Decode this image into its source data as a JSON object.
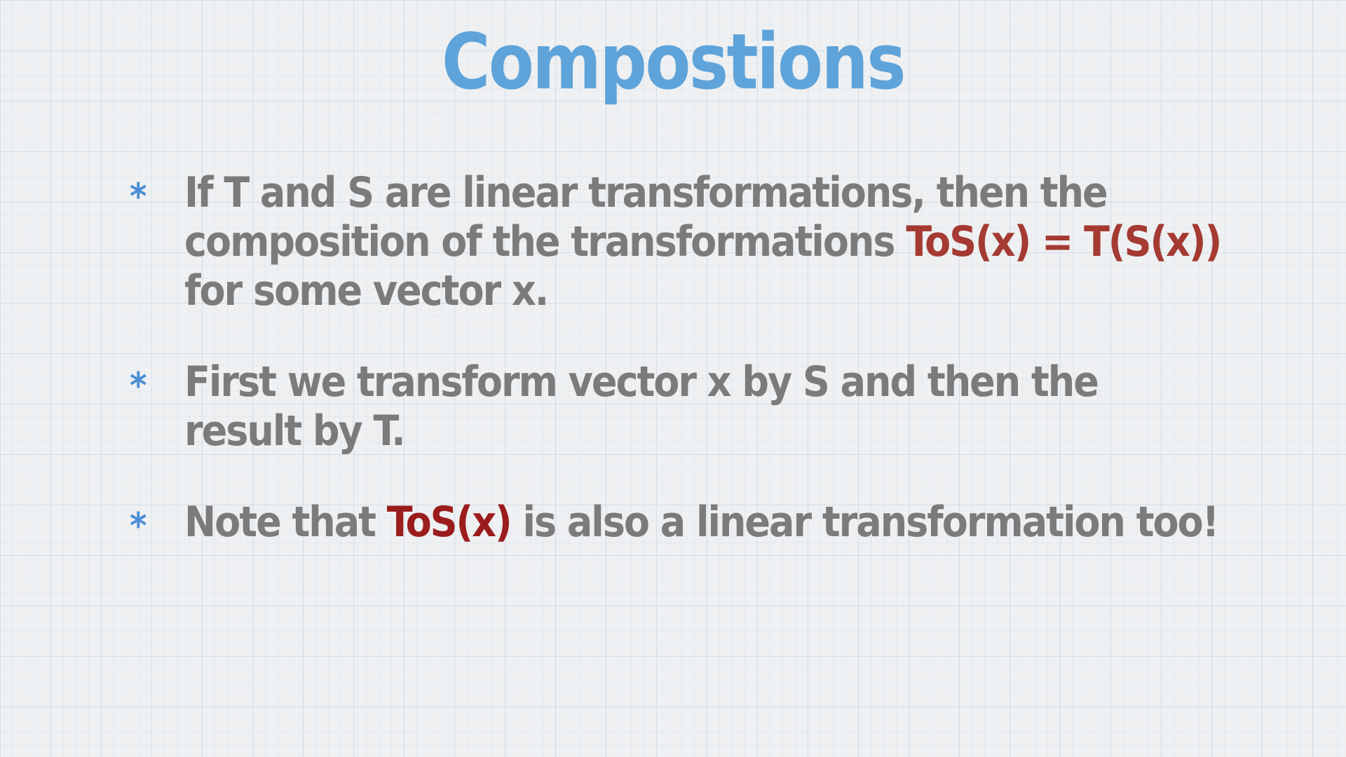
{
  "slide": {
    "title": "Compostions",
    "bullet_marker": "*",
    "bullets": [
      {
        "before": "If T and S are linear transformations, then the composition of the transformations ",
        "highlight": "ToS(x) = T(S(x))",
        "after": " for some vector x."
      },
      {
        "text": "First we transform vector x by S and then the result by T."
      },
      {
        "before": "Note that ",
        "highlight": "ToS(x)",
        "after": " is also a linear transformation too!"
      }
    ]
  },
  "colors": {
    "title": "#5ea3d9",
    "body_text": "#7b7b7b",
    "highlight": "#a43a32",
    "bullet_star": "#4a8fd6",
    "background": "#eef0f2"
  }
}
